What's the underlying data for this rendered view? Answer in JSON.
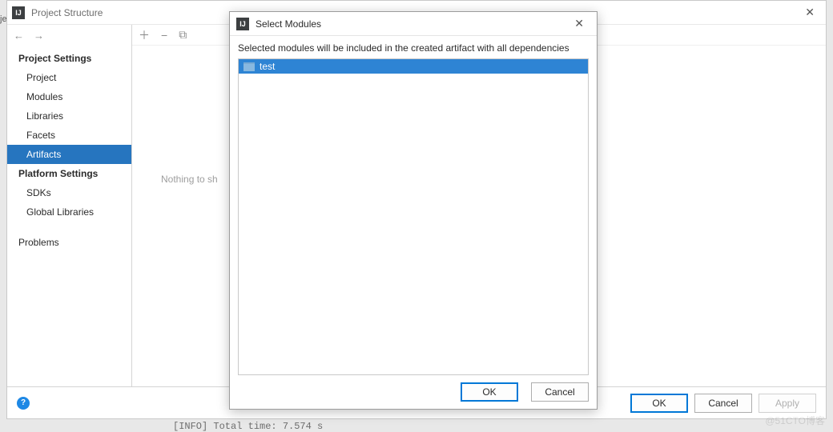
{
  "window": {
    "title": "Project Structure",
    "close_glyph": "✕"
  },
  "sidebar": {
    "back_glyph": "←",
    "fwd_glyph": "→",
    "section1": "Project Settings",
    "items1": {
      "project": "Project",
      "modules": "Modules",
      "libraries": "Libraries",
      "facets": "Facets",
      "artifacts": "Artifacts"
    },
    "section2": "Platform Settings",
    "items2": {
      "sdks": "SDKs",
      "global_libs": "Global Libraries"
    },
    "problems": "Problems"
  },
  "content": {
    "plus": "＋",
    "minus": "−",
    "copy": "⧉",
    "nothing": "Nothing to sh"
  },
  "footer": {
    "help": "?",
    "ok": "OK",
    "cancel": "Cancel",
    "apply": "Apply"
  },
  "status": "[INFO] Total time:  7.574 s",
  "modal": {
    "title": "Select Modules",
    "close_glyph": "✕",
    "desc": "Selected modules will be included in the created artifact with all dependencies",
    "module_name": "test",
    "ok": "OK",
    "cancel": "Cancel"
  },
  "sliver": "je",
  "watermark": "@51CTO博客"
}
